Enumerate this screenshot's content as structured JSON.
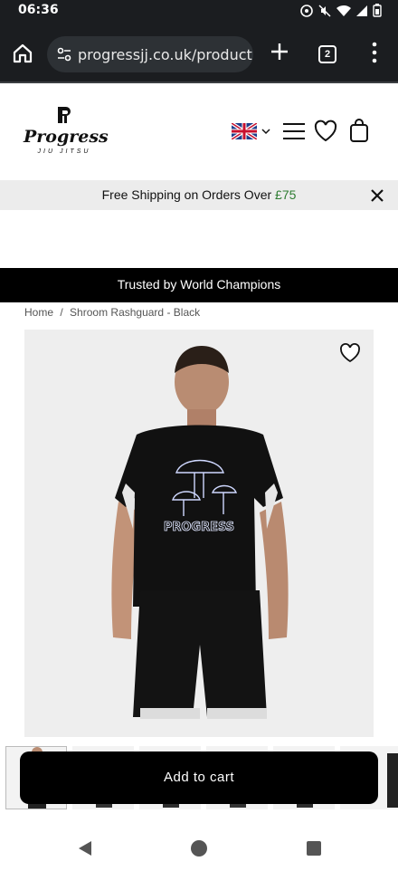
{
  "status_bar": {
    "time": "06:36"
  },
  "browser": {
    "url": "progressjj.co.uk/product",
    "tab_count": "2"
  },
  "brand": {
    "name": "Progress",
    "tagline": "JIU JITSU"
  },
  "promo": {
    "text_before": "Free Shipping on Orders Over ",
    "amount": "£75",
    "accent_color": "#2e7d32"
  },
  "trust": {
    "text": "Trusted by World Champions"
  },
  "breadcrumb": {
    "home": "Home",
    "separator": "/",
    "current": "Shroom Rashguard - Black"
  },
  "product": {
    "print_text": "PROGRESS",
    "add_to_cart_label": "Add to cart"
  },
  "icons": {
    "home": "home-icon",
    "site-info": "tune-icon",
    "plus": "plus-icon",
    "more": "more-vert-icon",
    "flag": "uk-flag-icon",
    "menu": "hamburger-icon",
    "wishlist": "heart-icon",
    "bag": "bag-icon",
    "close": "close-icon"
  }
}
